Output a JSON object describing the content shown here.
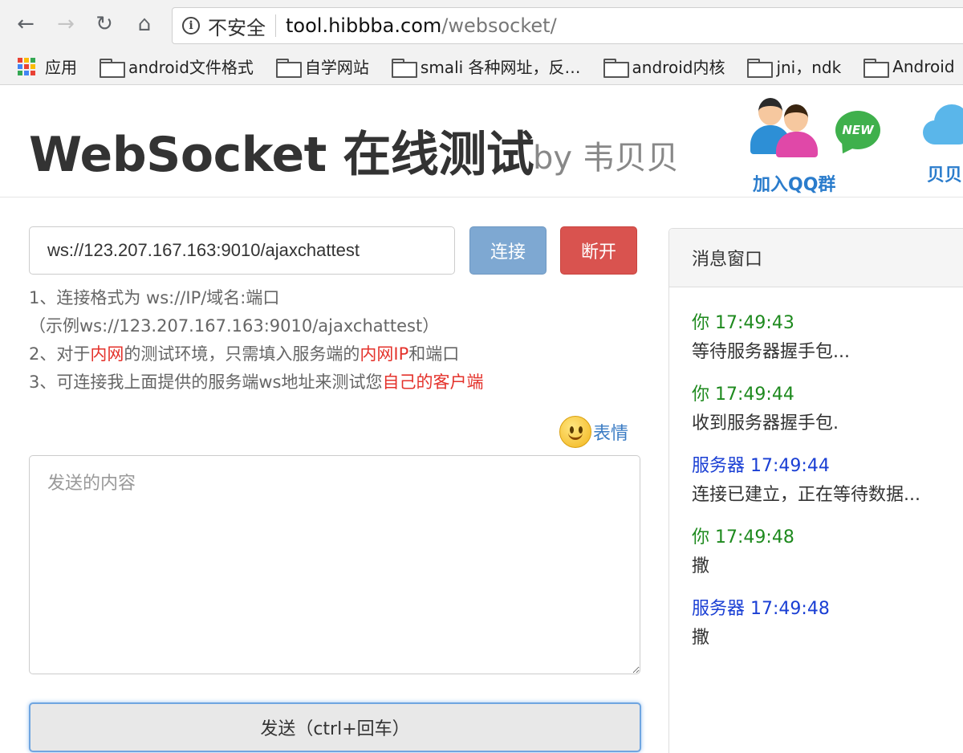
{
  "browser": {
    "security_label": "不安全",
    "url_host": "tool.hibbba.com",
    "url_path": "/websocket/",
    "bookmarks": [
      {
        "label": "应用",
        "icon": "apps-grid-icon"
      },
      {
        "label": "android文件格式",
        "icon": "folder-icon"
      },
      {
        "label": "自学网站",
        "icon": "folder-icon"
      },
      {
        "label": "smali 各种网址，反…",
        "icon": "folder-icon"
      },
      {
        "label": "android内核",
        "icon": "folder-icon"
      },
      {
        "label": "jni，ndk",
        "icon": "folder-icon"
      },
      {
        "label": "Android",
        "icon": "folder-icon"
      }
    ]
  },
  "header": {
    "title": "WebSocket 在线测试",
    "byline": "by 韦贝贝",
    "qq_label": "加入QQ群",
    "new_badge": "NEW",
    "cloud_label": "贝贝"
  },
  "connect": {
    "url_value": "ws://123.207.167.163:9010/ajaxchattest",
    "connect_label": "连接",
    "disconnect_label": "断开"
  },
  "help": {
    "line1": "1、连接格式为 ws://IP/域名:端口",
    "line1b": "（示例ws://123.207.167.163:9010/ajaxchattest）",
    "line2_a": "2、对于",
    "line2_b": "内网",
    "line2_c": "的测试环境，只需填入服务端的",
    "line2_d": "内网IP",
    "line2_e": "和端口",
    "line3_a": "3、可连接我上面提供的服务端ws地址来测试您",
    "line3_b": "自己的客户端"
  },
  "compose": {
    "emoji_label": "表情",
    "placeholder": "发送的内容",
    "send_label": "发送（ctrl+回车）"
  },
  "messages_panel": {
    "title": "消息窗口",
    "messages": [
      {
        "sender": "你",
        "time": "17:49:43",
        "text": "等待服务器握手包...",
        "kind": "you"
      },
      {
        "sender": "你",
        "time": "17:49:44",
        "text": "收到服务器握手包.",
        "kind": "you"
      },
      {
        "sender": "服务器",
        "time": "17:49:44",
        "text": "连接已建立，正在等待数据...",
        "kind": "server"
      },
      {
        "sender": "你",
        "time": "17:49:48",
        "text": "撒",
        "kind": "you"
      },
      {
        "sender": "服务器",
        "time": "17:49:48",
        "text": "撒",
        "kind": "server"
      }
    ]
  },
  "colors": {
    "you": "#1e8a1e",
    "server": "#1a3fd4",
    "highlight_red": "#e4322b",
    "connect_btn": "#7ea8d2",
    "disconnect_btn": "#d9534f"
  }
}
